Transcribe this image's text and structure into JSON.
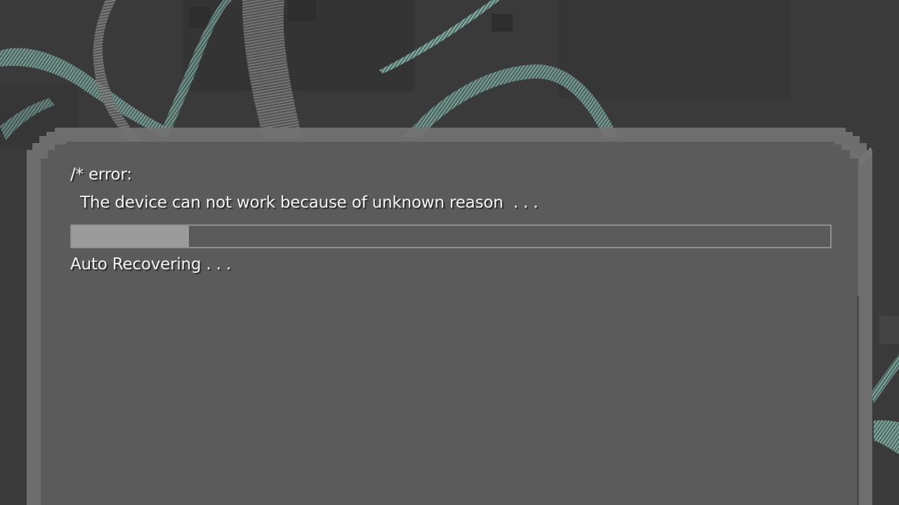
{
  "error_screen": {
    "header": "/* error:",
    "message": " The device can not work because of unknown reason  . . .",
    "progress": 0.155,
    "status": "Auto Recovering . . ."
  },
  "colors": {
    "background": "#3a3a3a",
    "panel": "#5b5b5b",
    "panel_border": "#7a7a7a",
    "progress_fill": "#9b9b9b",
    "progress_border": "#8e8e8e",
    "text": "#f2f2f2",
    "strand": "#6fa59b"
  },
  "icons": [
    "teal-strand-decoration"
  ]
}
